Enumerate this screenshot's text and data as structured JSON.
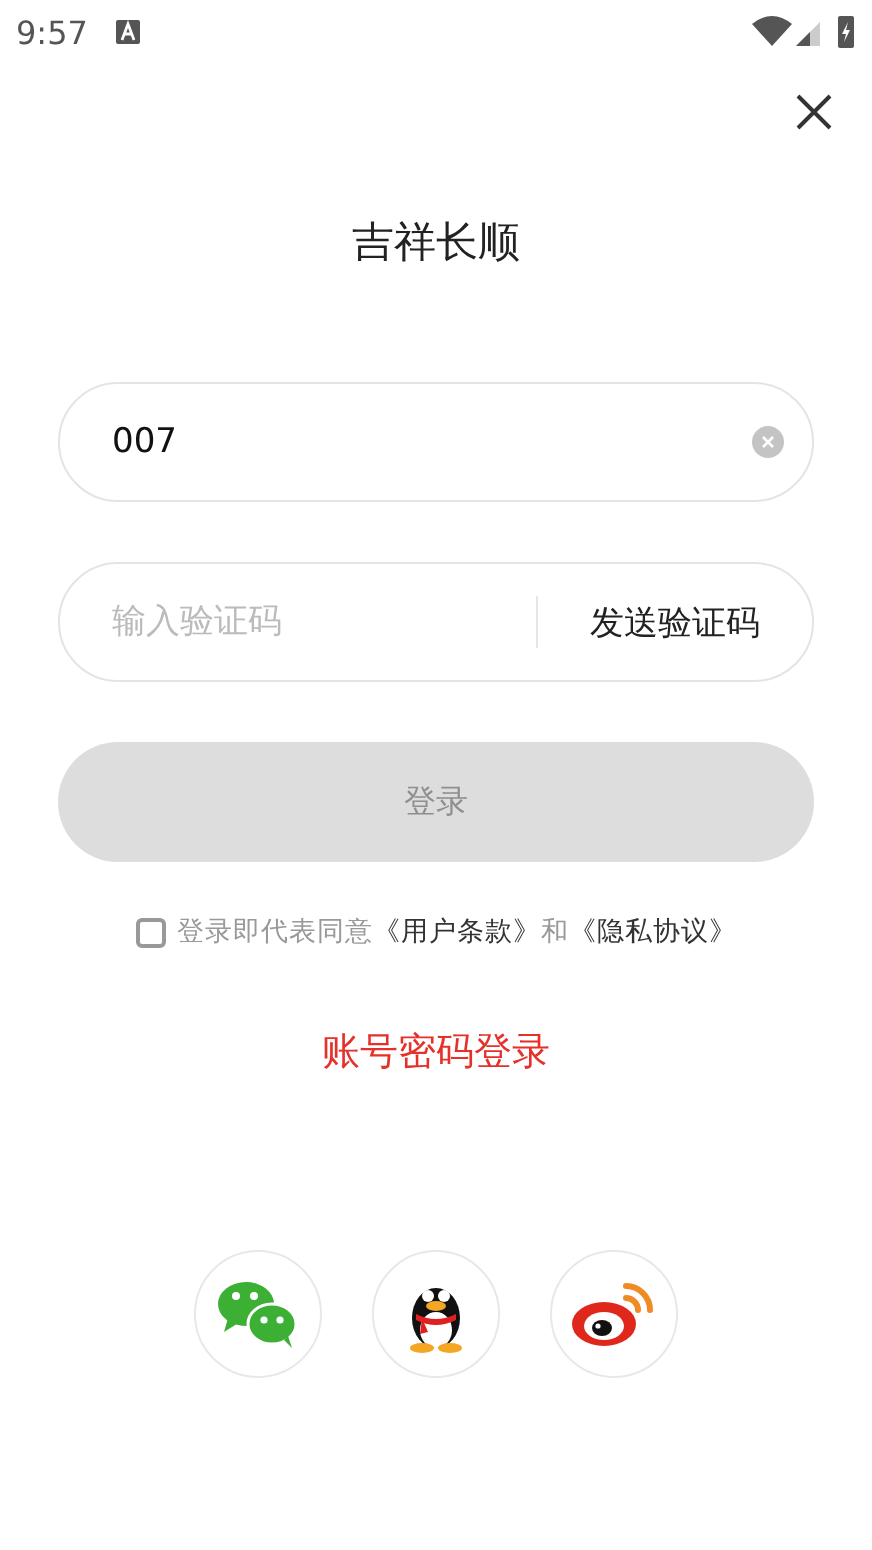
{
  "status_bar": {
    "time": "9:57"
  },
  "title": "吉祥长顺",
  "phone_field": {
    "value": "007"
  },
  "code_field": {
    "placeholder": "输入验证码",
    "send_button": "发送验证码"
  },
  "login_button": {
    "label": "登录",
    "disabled": true
  },
  "agreement": {
    "checked": false,
    "prefix": "登录即代表同意",
    "terms_link": "《用户条款》",
    "joiner": "和",
    "privacy_link": "《隐私协议》"
  },
  "password_login_link": "账号密码登录",
  "social_logins": [
    {
      "kind": "wechat"
    },
    {
      "kind": "qq"
    },
    {
      "kind": "weibo"
    }
  ]
}
